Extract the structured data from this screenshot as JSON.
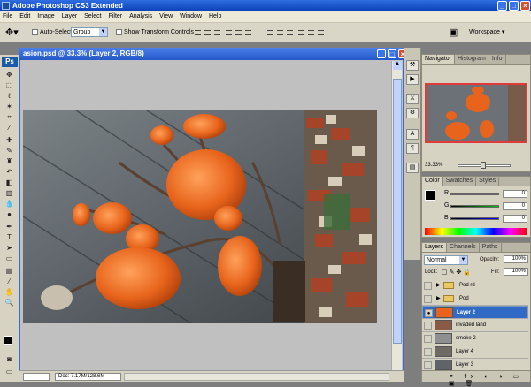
{
  "app": {
    "title": "Adobe Photoshop CS3 Extended",
    "window_buttons": [
      "_",
      "□",
      "×"
    ]
  },
  "menu": [
    "File",
    "Edit",
    "Image",
    "Layer",
    "Select",
    "Filter",
    "Analysis",
    "View",
    "Window",
    "Help"
  ],
  "options": {
    "auto_select_label": "Auto-Select",
    "auto_select_value": "Group",
    "show_transform_label": "Show Transform Controls",
    "workspace_label": "Workspace ▾"
  },
  "document": {
    "title": "asion.psd @ 33.3% (Layer 2, RGB/8)",
    "status": "Doc: 7.17M/128.6M"
  },
  "navigator": {
    "tabs": [
      "Navigator",
      "Histogram",
      "Info"
    ],
    "zoom": "33.33%"
  },
  "color": {
    "tabs": [
      "Color",
      "Swatches",
      "Styles"
    ],
    "r": "0",
    "g": "0",
    "b": "0"
  },
  "layers": {
    "tabs": [
      "Layers",
      "Channels",
      "Paths"
    ],
    "blend_mode": "Normal",
    "opacity_label": "Opacity:",
    "opacity": "100%",
    "lock_label": "Lock:",
    "fill_label": "Fill:",
    "fill": "100%",
    "items": [
      {
        "name": "Pod rd",
        "type": "group",
        "visible": false
      },
      {
        "name": "Pod",
        "type": "group",
        "visible": false
      },
      {
        "name": "Layer 2",
        "type": "layer",
        "visible": true,
        "selected": true
      },
      {
        "name": "invaded land",
        "type": "layer",
        "visible": false
      },
      {
        "name": "smoke 2",
        "type": "layer",
        "visible": false
      },
      {
        "name": "Layer 4",
        "type": "layer",
        "visible": false
      },
      {
        "name": "Layer 3",
        "type": "layer",
        "visible": false
      }
    ]
  },
  "colors": {
    "accent": "#316ac5",
    "pod_orange": "#e8641c"
  }
}
